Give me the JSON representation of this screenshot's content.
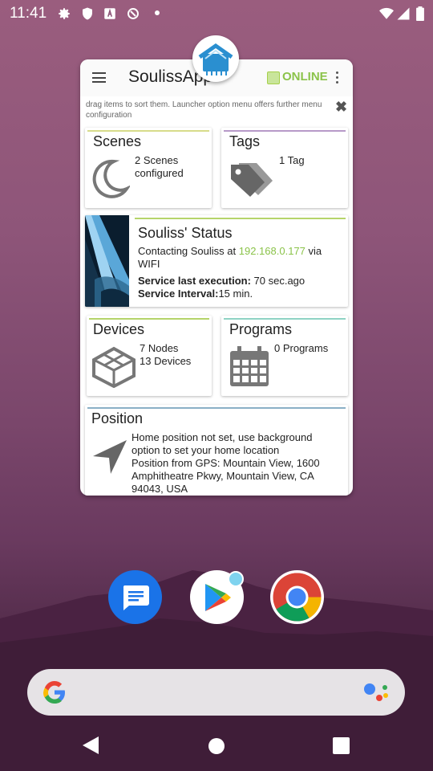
{
  "status_bar": {
    "time": "11:41"
  },
  "app": {
    "title": "SoulissApp",
    "status": "ONLINE",
    "hint": "drag items to sort them. Launcher option menu offers further menu configuration",
    "close_glyph": "✖"
  },
  "tiles": {
    "scenes": {
      "title": "Scenes",
      "line1": "2 Scenes",
      "line2": "configured"
    },
    "tags": {
      "title": "Tags",
      "line1": "1 Tag"
    },
    "status": {
      "title": "Souliss' Status",
      "contacting_prefix": "Contacting Souliss at",
      "ip": "192.168.0.177",
      "via": "via",
      "network": "WIFI",
      "last_exec_label": "Service last execution:",
      "last_exec_value": "70 sec.ago",
      "interval_label": "Service Interval:",
      "interval_value": "15 min."
    },
    "devices": {
      "title": "Devices",
      "line1": "7 Nodes",
      "line2": "13 Devices"
    },
    "programs": {
      "title": "Programs",
      "line1": "0 Programs"
    },
    "position": {
      "title": "Position",
      "line1": "Home position not set, use background",
      "line2": "option to set your home location",
      "line3": "Position from GPS: Mountain View, 1600",
      "line4": "Amphitheatre Pkwy, Mountain View, CA",
      "line5": "94043, USA"
    }
  },
  "colors": {
    "accent_green": "#8bc34a",
    "scenes_bar": "#d7dc8a",
    "tags_bar": "#b79ac8",
    "status_bar": "#b5d46a",
    "devices_bar": "#b5d46a",
    "programs_bar": "#8fd3c4",
    "position_bar": "#8ab0c6"
  },
  "dock": [
    "messages-icon",
    "play-store-icon",
    "chrome-icon"
  ],
  "nav": [
    "back-icon",
    "home-icon",
    "recents-icon"
  ]
}
